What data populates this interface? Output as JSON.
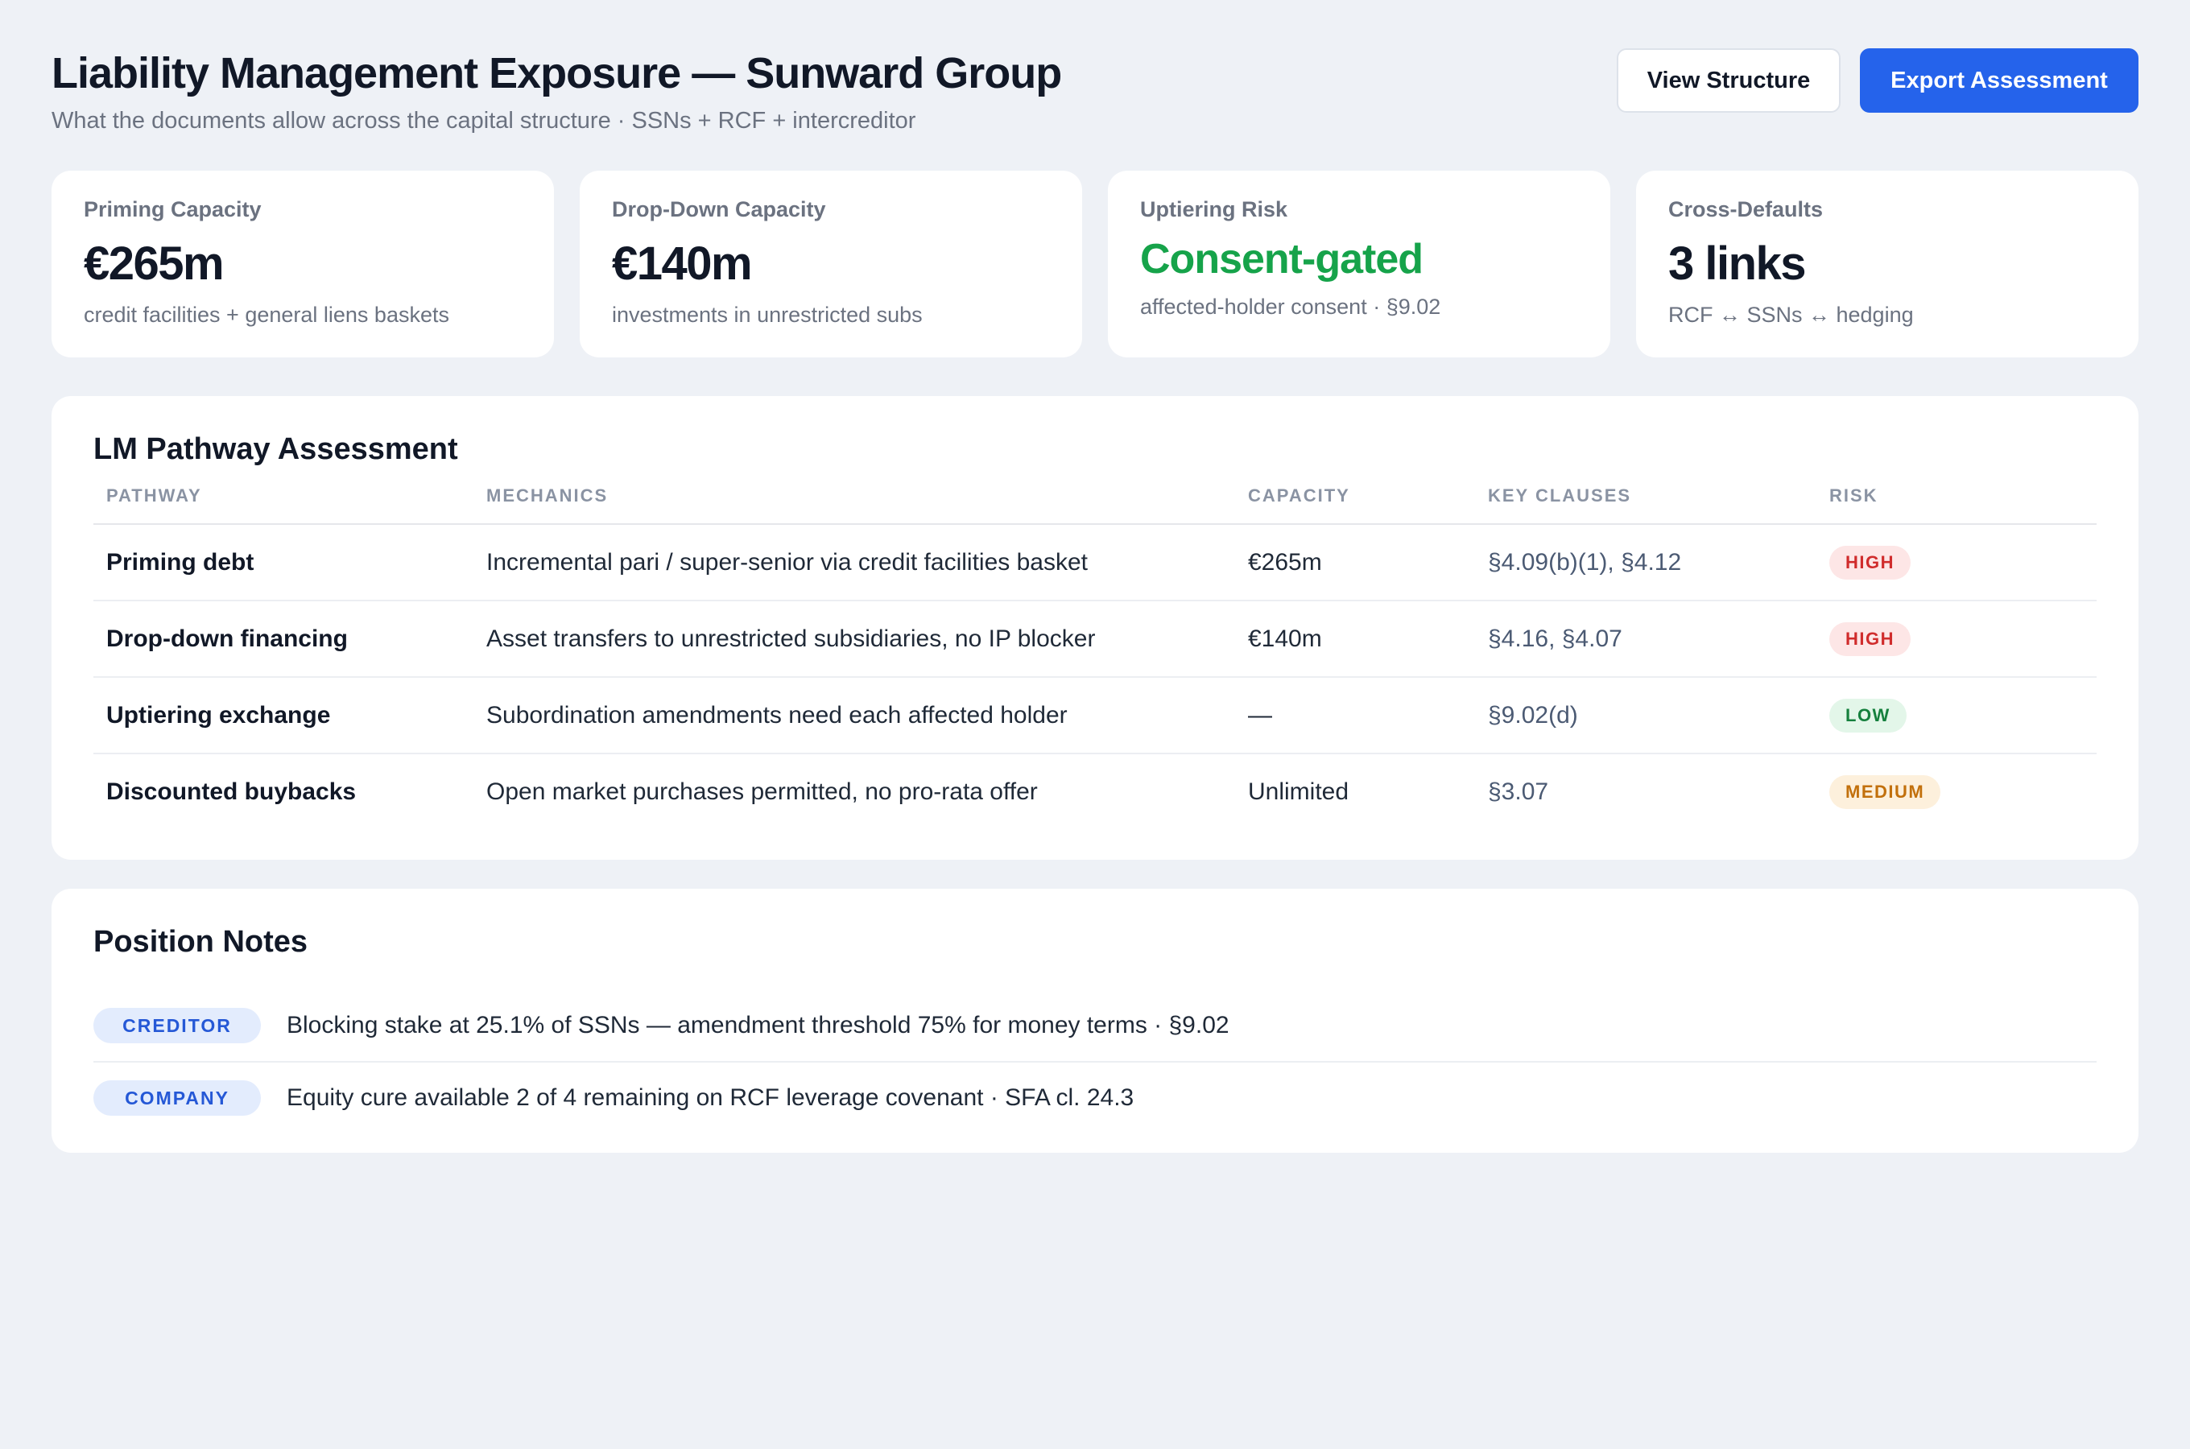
{
  "header": {
    "title": "Liability Management Exposure — Sunward Group",
    "subtitle": "What the documents allow across the capital structure · SSNs + RCF + intercreditor",
    "view_button": "View Structure",
    "export_button": "Export Assessment"
  },
  "kpis": [
    {
      "label": "Priming Capacity",
      "value": "€265m",
      "sub": "credit facilities + general liens baskets"
    },
    {
      "label": "Drop-Down Capacity",
      "value": "€140m",
      "sub": "investments in unrestricted subs"
    },
    {
      "label": "Uptiering Risk",
      "value": "Consent-gated",
      "sub": "affected-holder consent · §9.02",
      "value_color": "#16a34a"
    },
    {
      "label": "Cross-Defaults",
      "value": "3 links",
      "sub": "RCF ↔ SSNs ↔ hedging"
    }
  ],
  "lm": {
    "title": "LM Pathway Assessment",
    "columns": [
      "PATHWAY",
      "MECHANICS",
      "CAPACITY",
      "KEY CLAUSES",
      "RISK"
    ],
    "rows": [
      {
        "pathway": "Priming debt",
        "mechanics": "Incremental pari / super-senior via credit facilities basket",
        "capacity": "€265m",
        "clauses": "§4.09(b)(1), §4.12",
        "risk": "HIGH"
      },
      {
        "pathway": "Drop-down financing",
        "mechanics": "Asset transfers to unrestricted subsidiaries, no IP blocker",
        "capacity": "€140m",
        "clauses": "§4.16, §4.07",
        "risk": "HIGH"
      },
      {
        "pathway": "Uptiering exchange",
        "mechanics": "Subordination amendments need each affected holder",
        "capacity": "—",
        "clauses": "§9.02(d)",
        "risk": "LOW"
      },
      {
        "pathway": "Discounted buybacks",
        "mechanics": "Open market purchases permitted, no pro-rata offer",
        "capacity": "Unlimited",
        "clauses": "§3.07",
        "risk": "MEDIUM"
      }
    ]
  },
  "notes": {
    "title": "Position Notes",
    "items": [
      {
        "tag": "CREDITOR",
        "text": "Blocking stake at 25.1% of SSNs — amendment threshold 75% for money terms · §9.02"
      },
      {
        "tag": "COMPANY",
        "text": "Equity cure available 2 of 4 remaining on RCF leverage covenant · SFA cl. 24.3"
      }
    ]
  },
  "colors": {
    "background": "#eef1f6",
    "primary": "#2563eb",
    "success": "#16a34a",
    "risk_high": "#d02c2c",
    "risk_low": "#15803d",
    "risk_medium": "#c2700c"
  }
}
